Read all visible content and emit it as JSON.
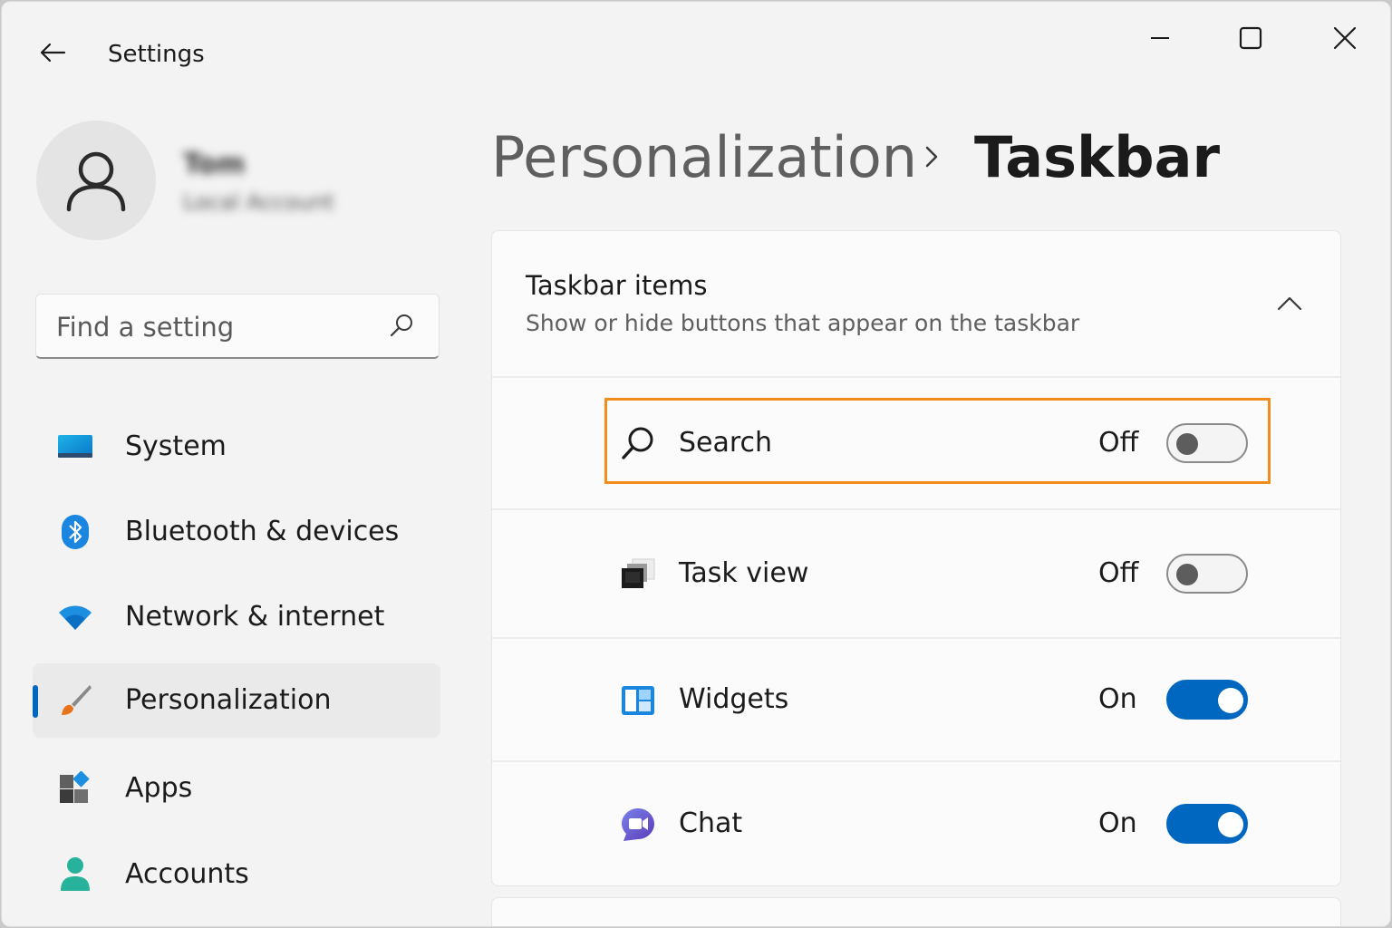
{
  "window": {
    "title": "Settings"
  },
  "profile": {
    "name": "Tom",
    "account_type": "Local Account"
  },
  "search": {
    "placeholder": "Find a setting"
  },
  "nav": {
    "items": [
      {
        "label": "System",
        "icon": "system-display-icon"
      },
      {
        "label": "Bluetooth & devices",
        "icon": "bluetooth-icon"
      },
      {
        "label": "Network & internet",
        "icon": "wifi-icon"
      },
      {
        "label": "Personalization",
        "icon": "paintbrush-icon",
        "selected": true
      },
      {
        "label": "Apps",
        "icon": "apps-icon"
      },
      {
        "label": "Accounts",
        "icon": "person-icon"
      }
    ]
  },
  "breadcrumb": {
    "parent": "Personalization",
    "separator": "›",
    "current": "Taskbar"
  },
  "taskbar_items": {
    "title": "Taskbar items",
    "description": "Show or hide buttons that appear on the taskbar",
    "rows": [
      {
        "label": "Search",
        "state": "Off",
        "on": false,
        "icon": "search-icon",
        "highlighted": true
      },
      {
        "label": "Task view",
        "state": "Off",
        "on": false,
        "icon": "task-view-icon"
      },
      {
        "label": "Widgets",
        "state": "On",
        "on": true,
        "icon": "widgets-icon"
      },
      {
        "label": "Chat",
        "state": "On",
        "on": true,
        "icon": "chat-icon"
      }
    ]
  },
  "colors": {
    "accent": "#0067c0",
    "highlight": "#f28c1b",
    "background": "#f3f3f3",
    "card": "#fbfbfb"
  }
}
